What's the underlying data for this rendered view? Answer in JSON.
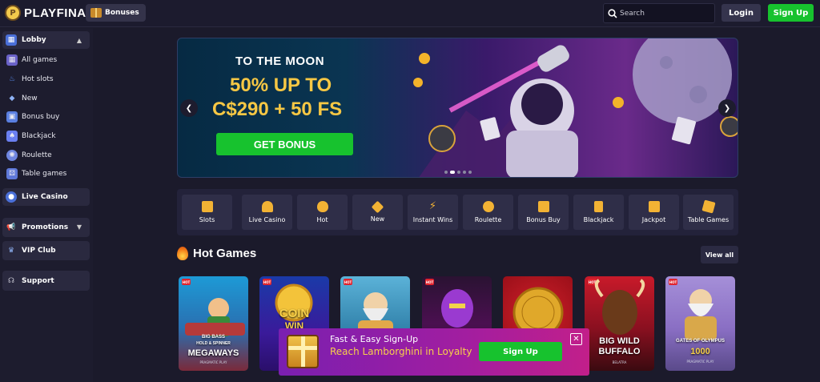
{
  "header": {
    "logo_text": "PLAYFINA",
    "bonuses_label": "Bonuses",
    "search_placeholder": "Search",
    "login_label": "Login",
    "signup_label": "Sign Up"
  },
  "sidebar": {
    "lobby_label": "Lobby",
    "items": [
      {
        "label": "All games",
        "icon": "grid-icon"
      },
      {
        "label": "Hot slots",
        "icon": "flame-icon"
      },
      {
        "label": "New",
        "icon": "diamond-icon"
      },
      {
        "label": "Bonus buy",
        "icon": "gift-icon"
      },
      {
        "label": "Blackjack",
        "icon": "cards-icon"
      },
      {
        "label": "Roulette",
        "icon": "roulette-icon"
      },
      {
        "label": "Table games",
        "icon": "dice-icon"
      }
    ],
    "live_casino_label": "Live Casino",
    "promotions_label": "Promotions",
    "vip_label": "VIP Club",
    "support_label": "Support"
  },
  "banner": {
    "title": "TO THE MOON",
    "line1": "50% UP TO",
    "line2": "C$290 + 50 FS",
    "cta": "GET BONUS",
    "slide_count": 5,
    "active_slide": 2
  },
  "categories": [
    {
      "label": "Slots",
      "icon": "slots-icon"
    },
    {
      "label": "Live Casino",
      "icon": "live-icon"
    },
    {
      "label": "Hot",
      "icon": "flame-icon"
    },
    {
      "label": "New",
      "icon": "diamond-icon"
    },
    {
      "label": "Instant Wins",
      "icon": "lightning-icon"
    },
    {
      "label": "Roulette",
      "icon": "roulette-icon"
    },
    {
      "label": "Bonus Buy",
      "icon": "gift-icon"
    },
    {
      "label": "Blackjack",
      "icon": "cards-icon"
    },
    {
      "label": "Jackpot",
      "icon": "crown-icon"
    },
    {
      "label": "Table Games",
      "icon": "dice-icon"
    }
  ],
  "hot_games": {
    "title": "Hot Games",
    "view_all": "View all",
    "badge": "HOT",
    "games": [
      {
        "name_line1": "BIG BASS",
        "name_line2": "HOLD & SPINNER",
        "name_line3": "MEGAWAYS",
        "provider": "PRAGMATIC PLAY"
      },
      {
        "name_line1": "COIN",
        "name_line2": "WIN",
        "name_line3": "",
        "provider": ""
      },
      {
        "name_line1": "",
        "name_line2": "",
        "name_line3": "",
        "provider": ""
      },
      {
        "name_line1": "",
        "name_line2": "",
        "name_line3": "",
        "provider": ""
      },
      {
        "name_line1": "",
        "name_line2": "",
        "name_line3": "",
        "provider": ""
      },
      {
        "name_line1": "BIG WILD",
        "name_line2": "BUFFALO",
        "name_line3": "",
        "provider": "BELATRA"
      },
      {
        "name_line1": "GATES OF OLYMPUS",
        "name_line2": "1000",
        "name_line3": "",
        "provider": "PRAGMATIC PLAY"
      }
    ]
  },
  "popup": {
    "title": "Fast & Easy Sign-Up",
    "promo": "Reach Lamborghini in Loyalty",
    "signup_label": "Sign Up",
    "close_symbol": "✕"
  },
  "colors": {
    "accent_green": "#17c22e",
    "gold": "#f6c744",
    "background": "#1b1a2b"
  }
}
